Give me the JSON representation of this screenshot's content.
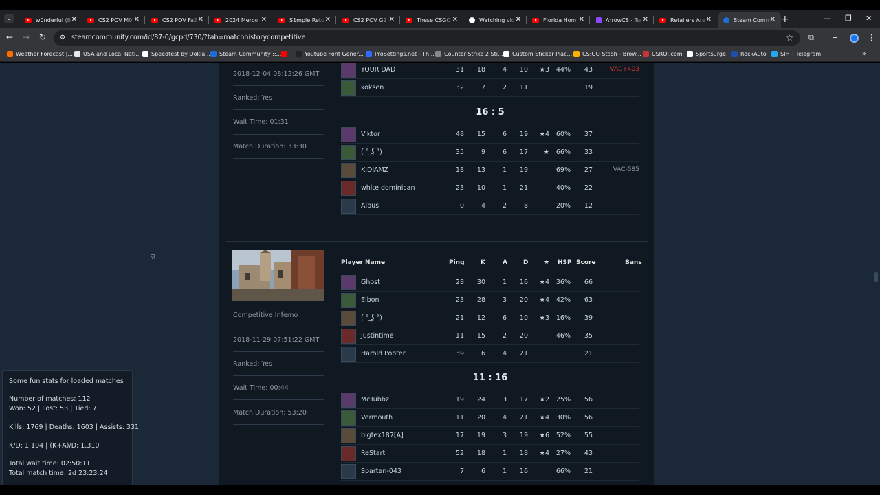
{
  "browser": {
    "tabs": [
      {
        "title": "w0nderful (B",
        "icon": "youtube-icon"
      },
      {
        "title": "CS2 POV M0",
        "icon": "youtube-icon"
      },
      {
        "title": "CS2 POV FaZ",
        "icon": "youtube-icon"
      },
      {
        "title": "2024 Merce",
        "icon": "youtube-icon"
      },
      {
        "title": "S1mple Retu",
        "icon": "youtube-icon"
      },
      {
        "title": "CS2 POV G2",
        "icon": "youtube-icon"
      },
      {
        "title": "These CSGO",
        "icon": "youtube-icon"
      },
      {
        "title": "Watching vid",
        "icon": "google-icon"
      },
      {
        "title": "Florida Hom",
        "icon": "youtube-icon"
      },
      {
        "title": "ArrowCS - Tw",
        "icon": "twitch-icon"
      },
      {
        "title": "Retailers Are",
        "icon": "youtube-icon"
      },
      {
        "title": "Steam Comm",
        "icon": "steam-icon"
      }
    ],
    "url": "steamcommunity.com/id/87-0/gcpd/730/?tab=matchhistorycompetitive",
    "bookmarks": [
      "Weather Forecast |...",
      "USA and Local Nati...",
      "Speedtest by Ookla...",
      "Steam Community ::...",
      "",
      "Youtube Font Gener...",
      "ProSettings.net - Th...",
      "Counter-Strike 2 Sti...",
      "Custom Sticker Plac...",
      "CS:GO Stash - Brow...",
      "CSROI.com",
      "Sportsurge",
      "RockAuto",
      "SIH – Telegram"
    ],
    "colors": {
      "tab_bg": "#202124",
      "toolbar_bg": "#35363a",
      "youtube_red": "#ff0000"
    }
  },
  "headers": {
    "player": "Player Name",
    "ping": "Ping",
    "k": "K",
    "a": "A",
    "d": "D",
    "mvp": "★",
    "hsp": "HSP",
    "score": "Score",
    "bans": "Bans"
  },
  "match1": {
    "info": {
      "date": "2018-12-04 08:12:26 GMT",
      "ranked": "Ranked: Yes",
      "wait": "Wait Time: 01:31",
      "duration": "Match Duration: 33:30"
    },
    "team1": [
      {
        "name": "YOUR DAD",
        "ping": "31",
        "k": "18",
        "a": "4",
        "d": "10",
        "mvp": "★3",
        "hsp": "44%",
        "score": "43",
        "ban": "VAC+403"
      },
      {
        "name": "koksen",
        "ping": "32",
        "k": "7",
        "a": "2",
        "d": "11",
        "mvp": "",
        "hsp": "",
        "score": "19",
        "ban": ""
      }
    ],
    "score": "16 : 5",
    "team2": [
      {
        "name": "Viktor",
        "ping": "48",
        "k": "15",
        "a": "6",
        "d": "19",
        "mvp": "★4",
        "hsp": "60%",
        "score": "37",
        "ban": ""
      },
      {
        "name": "( ͡° ͜ʖ ͡°)",
        "ping": "35",
        "k": "9",
        "a": "6",
        "d": "17",
        "mvp": "★",
        "hsp": "66%",
        "score": "33",
        "ban": ""
      },
      {
        "name": "KIDJAMZ",
        "ping": "18",
        "k": "13",
        "a": "1",
        "d": "19",
        "mvp": "",
        "hsp": "69%",
        "score": "27",
        "ban": "VAC-585"
      },
      {
        "name": "white dominican",
        "ping": "23",
        "k": "10",
        "a": "1",
        "d": "21",
        "mvp": "",
        "hsp": "40%",
        "score": "22",
        "ban": ""
      },
      {
        "name": "Albus",
        "ping": "0",
        "k": "4",
        "a": "2",
        "d": "8",
        "mvp": "",
        "hsp": "20%",
        "score": "12",
        "ban": ""
      }
    ]
  },
  "match2": {
    "info": {
      "map": "Competitive Inferno",
      "date": "2018-11-29 07:51:22 GMT",
      "ranked": "Ranked: Yes",
      "wait": "Wait Time: 00:44",
      "duration": "Match Duration: 53:20"
    },
    "team1": [
      {
        "name": "Ghost",
        "ping": "28",
        "k": "30",
        "a": "1",
        "d": "16",
        "mvp": "★4",
        "hsp": "36%",
        "score": "66",
        "ban": ""
      },
      {
        "name": "Elbon",
        "ping": "23",
        "k": "28",
        "a": "3",
        "d": "20",
        "mvp": "★4",
        "hsp": "42%",
        "score": "63",
        "ban": ""
      },
      {
        "name": "( ͡° ͜ʖ ͡°)",
        "ping": "21",
        "k": "12",
        "a": "6",
        "d": "10",
        "mvp": "★3",
        "hsp": "16%",
        "score": "39",
        "ban": ""
      },
      {
        "name": "Justintime",
        "ping": "11",
        "k": "15",
        "a": "2",
        "d": "20",
        "mvp": "",
        "hsp": "46%",
        "score": "35",
        "ban": ""
      },
      {
        "name": "Harold Pooter",
        "ping": "39",
        "k": "6",
        "a": "4",
        "d": "21",
        "mvp": "",
        "hsp": "",
        "score": "21",
        "ban": ""
      }
    ],
    "score": "11 : 16",
    "team2": [
      {
        "name": "McTubbz",
        "ping": "19",
        "k": "24",
        "a": "3",
        "d": "17",
        "mvp": "★2",
        "hsp": "25%",
        "score": "56",
        "ban": ""
      },
      {
        "name": "Vermouth",
        "ping": "11",
        "k": "20",
        "a": "4",
        "d": "21",
        "mvp": "★4",
        "hsp": "30%",
        "score": "56",
        "ban": ""
      },
      {
        "name": "bigtex187[A]",
        "ping": "17",
        "k": "19",
        "a": "3",
        "d": "19",
        "mvp": "★6",
        "hsp": "52%",
        "score": "55",
        "ban": ""
      },
      {
        "name": "ReStart",
        "ping": "52",
        "k": "18",
        "a": "1",
        "d": "18",
        "mvp": "★4",
        "hsp": "27%",
        "score": "43",
        "ban": ""
      },
      {
        "name": "Spartan-043",
        "ping": "7",
        "k": "6",
        "a": "1",
        "d": "16",
        "mvp": "",
        "hsp": "66%",
        "score": "21",
        "ban": ""
      }
    ]
  },
  "stats": {
    "title": "Some fun stats for loaded matches",
    "matches": "Number of matches: 112",
    "record": "Won: 52 | Lost: 53 | Tied: 7",
    "kda": "Kills: 1769 | Deaths: 1603 | Assists: 331",
    "ratio": "K/D: 1.104 | (K+A)/D: 1.310",
    "wait": "Total wait time: 02:50:11",
    "match_time": "Total match time: 2d 23:23:24"
  },
  "colors": {
    "page_bg": "#1b2838",
    "panel_bg": "#101822",
    "vac_red": "#d9342b",
    "vac_gray": "#8f98a0"
  }
}
